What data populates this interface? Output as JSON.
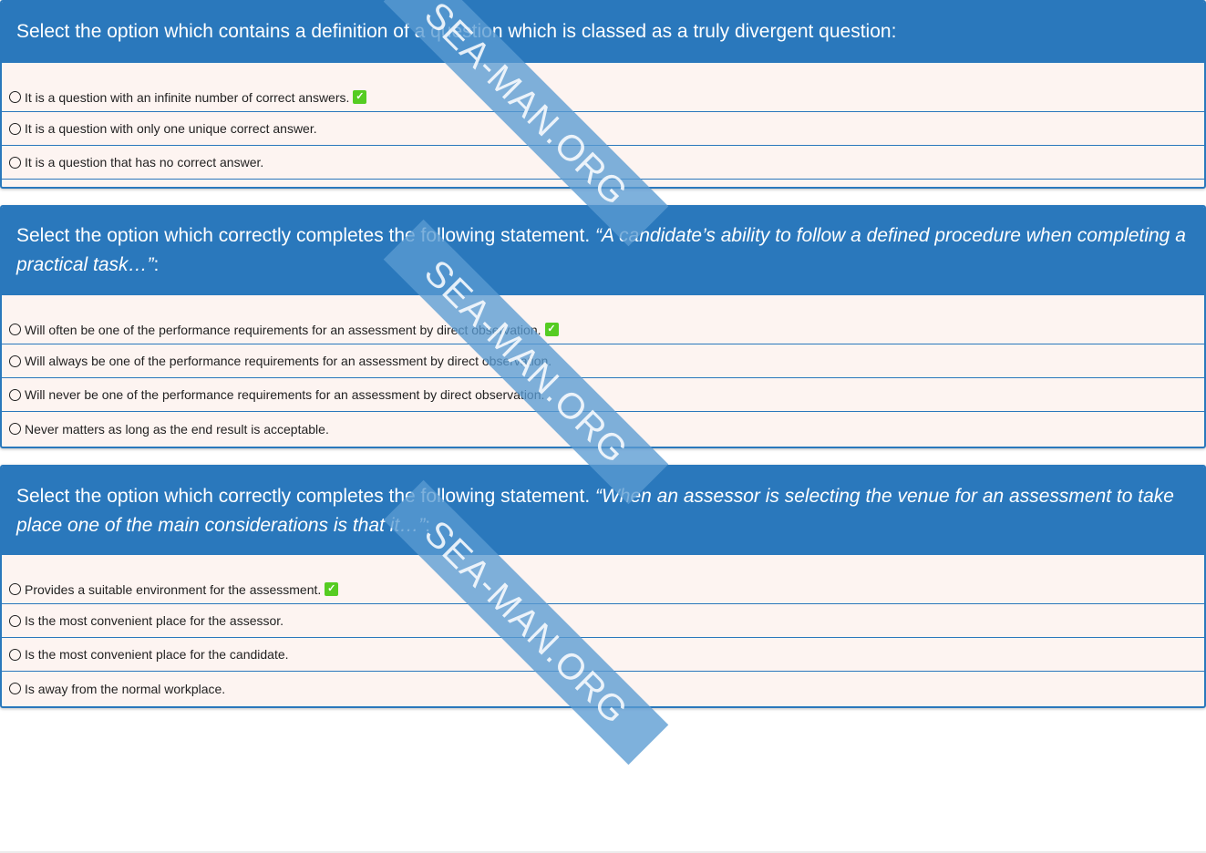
{
  "questions": [
    {
      "prompt": "Select the option which contains a definition of a question which is classed as a truly divergent question:",
      "options": [
        {
          "text": "It is a question with an infinite number of correct answers.",
          "correct": true
        },
        {
          "text": "It is a question with only one unique correct answer.",
          "correct": false
        },
        {
          "text": "It is a question that has no correct answer.",
          "correct": false
        }
      ]
    },
    {
      "prompt_lead": "Select the option which correctly completes the following statement. ",
      "prompt_quote": "“A candidate’s ability to follow a defined procedure when completing a practical task…”",
      "prompt_tail": ":",
      "options": [
        {
          "text": "Will often be one of the performance requirements for an assessment by direct observation.",
          "correct": true
        },
        {
          "text": "Will always be one of the performance requirements for an assessment by direct observation.",
          "correct": false
        },
        {
          "text": "Will never be one of the performance requirements for an assessment by direct observation.",
          "correct": false
        },
        {
          "text": "Never matters as long as the end result is acceptable.",
          "correct": false
        }
      ]
    },
    {
      "prompt_lead": "Select the option which correctly completes the following statement. ",
      "prompt_quote": "“When an assessor is selecting the venue for an assessment to take place one of the main considerations is that it…”",
      "prompt_tail": ":",
      "options": [
        {
          "text": "Provides a suitable environment for the assessment.",
          "correct": true
        },
        {
          "text": "Is the most convenient place for the assessor.",
          "correct": false
        },
        {
          "text": "Is the most convenient place for the candidate.",
          "correct": false
        },
        {
          "text": "Is away from the normal workplace.",
          "correct": false
        }
      ]
    }
  ],
  "watermark": "SEA-MAN.ORG",
  "colors": {
    "header_bg": "#2a78bc",
    "option_bg": "#fdf4f1",
    "correct_badge": "#55cc22"
  },
  "icons": {
    "radio": "radio-empty-icon",
    "correct": "checkmark-icon"
  }
}
